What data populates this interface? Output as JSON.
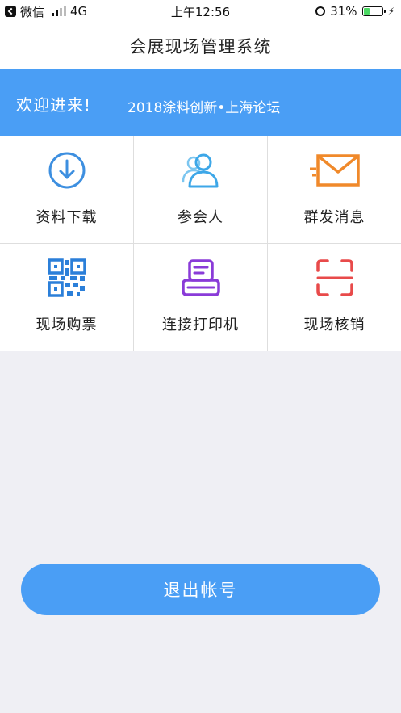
{
  "status_bar": {
    "back_app": "微信",
    "network": "4G",
    "time": "上午12:56",
    "battery_percent": "31%",
    "battery_level": 0.31
  },
  "header": {
    "title": "会展现场管理系统"
  },
  "banner": {
    "welcome": "欢迎进来!",
    "forum": "2018涂料创新•上海论坛"
  },
  "menu": {
    "items": [
      {
        "label": "资料下载",
        "icon": "download-icon",
        "color": "#3d8fe0"
      },
      {
        "label": "参会人",
        "icon": "attendees-icon",
        "color": "#3da7e8"
      },
      {
        "label": "群发消息",
        "icon": "mail-icon",
        "color": "#f0892a"
      },
      {
        "label": "现场购票",
        "icon": "qr-code-icon",
        "color": "#2b7fd9"
      },
      {
        "label": "连接打印机",
        "icon": "printer-icon",
        "color": "#8a3bd8"
      },
      {
        "label": "现场核销",
        "icon": "scan-icon",
        "color": "#e84a4a"
      }
    ]
  },
  "logout": {
    "label": "退出帐号"
  },
  "colors": {
    "accent": "#4a9ef5",
    "background": "#efeff4"
  }
}
